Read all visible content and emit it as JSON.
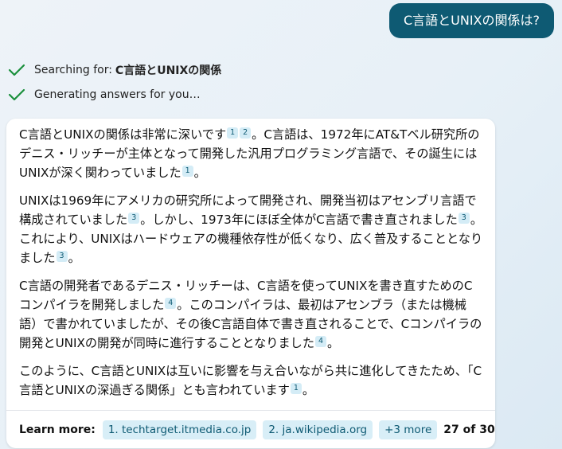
{
  "user_message": "C言語とUNIXの関係は?",
  "status": {
    "searching_label": "Searching for:",
    "searching_query": "C言語とUNIXの関係",
    "generating_label": "Generating answers for you…",
    "check_icon": "check-icon",
    "check_color": "#1a8f3c"
  },
  "answer": {
    "paragraphs": [
      [
        {
          "text": "C言語とUNIXの関係は非常に深いです"
        },
        {
          "ref": "1"
        },
        {
          "ref": "2"
        },
        {
          "text": "。C言語は、1972年にAT&Tベル研究所のデニス・リッチーが主体となって開発した汎用プログラミング言語で、その誕生にはUNIXが深く関わっていました"
        },
        {
          "ref": "1"
        },
        {
          "text": "。"
        }
      ],
      [
        {
          "text": "UNIXは1969年にアメリカの研究所によって開発され、開発当初はアセンブリ言語で構成されていました"
        },
        {
          "ref": "3"
        },
        {
          "text": "。しかし、1973年にほぼ全体がC言語で書き直されました"
        },
        {
          "ref": "3"
        },
        {
          "text": "。これにより、UNIXはハードウェアの機種依存性が低くなり、広く普及することとなりました"
        },
        {
          "ref": "3"
        },
        {
          "text": "。"
        }
      ],
      [
        {
          "text": "C言語の開発者であるデニス・リッチーは、C言語を使ってUNIXを書き直すためのCコンパイラを開発しました"
        },
        {
          "ref": "4"
        },
        {
          "text": "。このコンパイラは、最初はアセンブラ（または機械語）で書かれていましたが、その後C言語自体で書き直されることで、Cコンパイラの開発とUNIXの開発が同時に進行することとなりました"
        },
        {
          "ref": "4"
        },
        {
          "text": "。"
        }
      ],
      [
        {
          "text": "このように、C言語とUNIXは互いに影響を与え合いながら共に進化してきたため、「C言語とUNIXの深過ぎる関係」とも言われています"
        },
        {
          "ref": "1"
        },
        {
          "text": "。"
        }
      ]
    ]
  },
  "footer": {
    "learn_more_label": "Learn more:",
    "sources": [
      "1. techtarget.itmedia.co.jp",
      "2. ja.wikipedia.org"
    ],
    "more_label": "+3 more",
    "counter": "27 of 30",
    "counter_dot_color": "#f29c1d"
  }
}
